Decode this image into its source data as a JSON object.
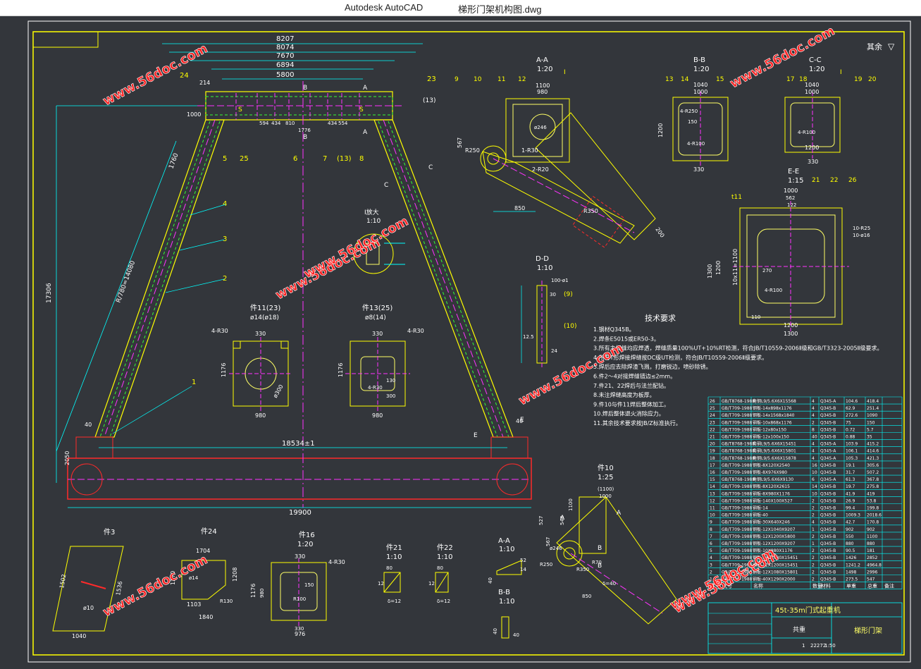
{
  "window": {
    "app_name": "Autodesk AutoCAD",
    "document_name": "梯形门架机构图.dwg"
  },
  "colors": {
    "background": "#33363b",
    "frame": "#ffff00",
    "dim": "#00ffff",
    "part": "#ffff66",
    "red": "#ff2a2a",
    "magenta": "#ff33ff",
    "green": "#33ff33",
    "watermark": "#ff2222"
  },
  "drawing": {
    "corner_note": "其余",
    "watermark": "www.56doc.com",
    "top_dims": [
      "8207",
      "8074",
      "7670",
      "6894",
      "5800"
    ],
    "small_dims": [
      "214",
      "1000",
      "594",
      "434",
      "810",
      "1776",
      "434",
      "554",
      "(13)",
      "1760",
      "17306",
      "R/780=14080",
      "18534±1",
      "19900",
      "2050",
      "40",
      "40"
    ],
    "balloons": [
      "24",
      "23",
      "5",
      "25",
      "6",
      "7",
      "(13)",
      "8",
      "4",
      "3",
      "2",
      "1"
    ],
    "section_marks": [
      "B",
      "B",
      "A",
      "A",
      "S",
      "S",
      "C",
      "C",
      "E",
      "E"
    ],
    "detail_I": {
      "title": "I放大",
      "scale": "1:10"
    },
    "part11_23": {
      "title": "件11(23)",
      "sub": "ø14(ø18)",
      "dims": [
        "330",
        "4-R30",
        "1176",
        "ø300",
        "980"
      ]
    },
    "part13_25": {
      "title": "件13(25)",
      "sub": "ø8(14)",
      "dims": [
        "330",
        "4-R30",
        "1176",
        "130",
        "4-R30",
        "300",
        "980"
      ]
    },
    "view_AA": {
      "title": "A-A",
      "scale": "1:20",
      "balloons": [
        "9",
        "10",
        "11",
        "12",
        "I"
      ],
      "dims": [
        "1100",
        "980",
        "R250",
        "1-R30",
        "2-R20",
        "850",
        "R350",
        "200",
        "567",
        "ø246"
      ]
    },
    "view_BB": {
      "title": "B-B",
      "scale": "1:20",
      "balloons": [
        "13",
        "14",
        "15"
      ],
      "dims": [
        "1040",
        "1000",
        "4-R250",
        "4-R100",
        "330",
        "1200",
        "150"
      ]
    },
    "view_CC": {
      "title": "C-C",
      "scale": "1:20",
      "balloons": [
        "17",
        "18",
        "I",
        "19",
        "20"
      ],
      "dims": [
        "1040",
        "1000",
        "4-R100",
        "330",
        "1200"
      ]
    },
    "view_EE": {
      "title": "E-E",
      "scale": "1:15",
      "balloons": [
        "t11",
        "21",
        "22",
        "26"
      ],
      "dims": [
        "1000",
        "562",
        "122",
        "1300",
        "1200",
        "10x11=1100",
        "1200",
        "1300",
        "270",
        "4-R100",
        "110",
        "10-R25",
        "10-ø16"
      ]
    },
    "view_DD": {
      "title": "D-D",
      "scale": "1:10",
      "dims": [
        "100-ø1",
        "(9)",
        "(10)",
        "30",
        "12.5",
        "24"
      ]
    },
    "tech_title": "技术要求",
    "tech_notes": [
      "1.钢材Q345B。",
      "2.焊条E5015或ER50-3。",
      "3.所有主焊缝均应焊透，焊缝质量100%UT+10%RT检测，符合JB/T10559-2006Ⅱ级和GB/T3323-2005Ⅱ级要求。",
      "4.所有T形焊接焊缝按DC级UT检测，符合JB/T10559-2006Ⅱ级要求。",
      "5.焊后应去除焊渣飞溅，打磨锐边，喷砂除锈。",
      "6.件2～4对接焊缝错边≤2mm。",
      "7.件21、22焊后与法兰配钻。",
      "8.未注焊缝高度为板厚。",
      "9.件10与件11焊后整体加工。",
      "10.焊后整体退火消除应力。",
      "11.其余技术要求按JB/Z标准执行。"
    ],
    "part3": {
      "title": "件3",
      "dims": [
        "1502",
        "1536",
        "ø10",
        "1040"
      ]
    },
    "part24": {
      "title": "件24",
      "dims": [
        "1704",
        "1270",
        "1208",
        "ø14",
        "1103",
        "1840",
        "R130"
      ]
    },
    "part16": {
      "title": "件16",
      "scale": "1:20",
      "dims": [
        "330",
        "4-R30",
        "150",
        "R100",
        "1176",
        "976",
        "980",
        "330"
      ]
    },
    "part21": {
      "title": "件21",
      "scale": "1:10",
      "dims": [
        "80",
        "12",
        "δ=12"
      ]
    },
    "part22": {
      "title": "件22",
      "scale": "1:10",
      "dims": [
        "80",
        "12",
        "δ=12"
      ]
    },
    "small_AA": {
      "title": "A-A",
      "scale": "1:10",
      "dims": [
        "52",
        "14",
        "40"
      ]
    },
    "small_BB": {
      "title": "B-B",
      "scale": "1:10",
      "dims": [
        "40",
        "40"
      ]
    },
    "part10": {
      "title": "件10",
      "scale": "1:25",
      "dims": [
        "(1100)",
        "1000",
        "R250",
        "ø246",
        "R350",
        "850",
        "R70",
        "δ=40",
        "527",
        "548",
        "567",
        "1100"
      ],
      "marks": [
        "A",
        "A",
        "B",
        "B"
      ]
    },
    "parts_list": {
      "rows": [
        [
          "26",
          "GB/T8768-1988",
          "角钢L9/5.6X6X15568",
          "4",
          "Q345-A",
          "104.6",
          "418.4"
        ],
        [
          "25",
          "GB/T709-1988",
          "钢板-14x898x1176",
          "4",
          "Q345-B",
          "62.9",
          "251.4"
        ],
        [
          "24",
          "GB/T709-1988",
          "钢板-14x1568x1840",
          "4",
          "Q345-B",
          "272.6",
          "1090"
        ],
        [
          "23",
          "GB/T709-1988",
          "钢板-10x868x1176",
          "2",
          "Q345-B",
          "75",
          "150"
        ],
        [
          "22",
          "GB/T709-1988",
          "钢板-12x80x150",
          "8",
          "Q345-B",
          "0.72",
          "5.7"
        ],
        [
          "21",
          "GB/T709-1988",
          "钢板-12x100x150",
          "40",
          "Q345-B",
          "0.88",
          "35"
        ],
        [
          "20",
          "GB/T8768-1988",
          "角钢L9/5.6X6X15451",
          "4",
          "Q345-A",
          "103.9",
          "415.2"
        ],
        [
          "19",
          "GB/T8768-1988",
          "角钢L9/5.6X6X15801",
          "4",
          "Q345-A",
          "106.1",
          "414.6"
        ],
        [
          "18",
          "GB/T8768-1988",
          "角钢L9/5.6X6X15878",
          "4",
          "Q345-A",
          "105.3",
          "421.3"
        ],
        [
          "17",
          "GB/T709-1988",
          "钢板-8X120X2540",
          "16",
          "Q345-B",
          "19.1",
          "305.6"
        ],
        [
          "16",
          "GB/T709-1988",
          "钢板-8X976X980",
          "10",
          "Q345-B",
          "31.7",
          "507.2"
        ],
        [
          "15",
          "GB/T8768-1988",
          "角钢L9/5.6X6X9130",
          "6",
          "Q345-A",
          "61.3",
          "367.8"
        ],
        [
          "14",
          "GB/T709-1988",
          "钢板-8X120X2615",
          "14",
          "Q345-B",
          "19.7",
          "275.8"
        ],
        [
          "13",
          "GB/T709-1988",
          "钢板-8X980X1176",
          "10",
          "Q345-B",
          "41.9",
          "419"
        ],
        [
          "12",
          "GB/T709-1988",
          "钢板-140X100X527",
          "2",
          "Q345-B",
          "26.9",
          "53.8"
        ],
        [
          "11",
          "GB/T709-1988",
          "钢板-14",
          "2",
          "Q345-B",
          "99.4",
          "199.8"
        ],
        [
          "10",
          "GB/T709-1988",
          "钢板-40",
          "2",
          "Q345-B",
          "1009.3",
          "2018.6"
        ],
        [
          "9",
          "GB/T709-1988",
          "钢板-30X640X246",
          "4",
          "Q345-B",
          "42.7",
          "170.8"
        ],
        [
          "8",
          "GB/T709-1988",
          "钢板-12X1040X9207",
          "1",
          "Q345-B",
          "902",
          "902"
        ],
        [
          "7",
          "GB/T709-1988",
          "钢板-12X1200X5800",
          "2",
          "Q345-B",
          "550",
          "1100"
        ],
        [
          "6",
          "GB/T709-1988",
          "钢板-12X1200X9207",
          "1",
          "Q345-B",
          "880",
          "880"
        ],
        [
          "5",
          "GB/T709-1988",
          "钢板-10X880X1176",
          "2",
          "Q345-B",
          "90.5",
          "181"
        ],
        [
          "4",
          "GB/T709-1988",
          "钢板-12X1080X15451",
          "2",
          "Q345-B",
          "1426",
          "2852"
        ],
        [
          "3",
          "GB/T709-1988",
          "钢板-12X1200X15451",
          "2",
          "Q345-B",
          "1241.2",
          "4964.8"
        ],
        [
          "2",
          "GB/T709-1988",
          "钢板-12X1080X15801",
          "2",
          "Q345-B",
          "1498",
          "2996"
        ],
        [
          "1",
          "GB/T709-1988",
          "钢板-40X1290X2000",
          "2",
          "Q345-B",
          "273.5",
          "547"
        ]
      ],
      "header": [
        "序号",
        "代号",
        "名称",
        "数量",
        "材料",
        "单重",
        "总重",
        "备注"
      ],
      "title_main": "45t-35m门式起重机",
      "title_part": "梯形门架",
      "weight_label": "共重",
      "sheet": "22272",
      "scale": "1:50",
      "page": "1"
    }
  }
}
